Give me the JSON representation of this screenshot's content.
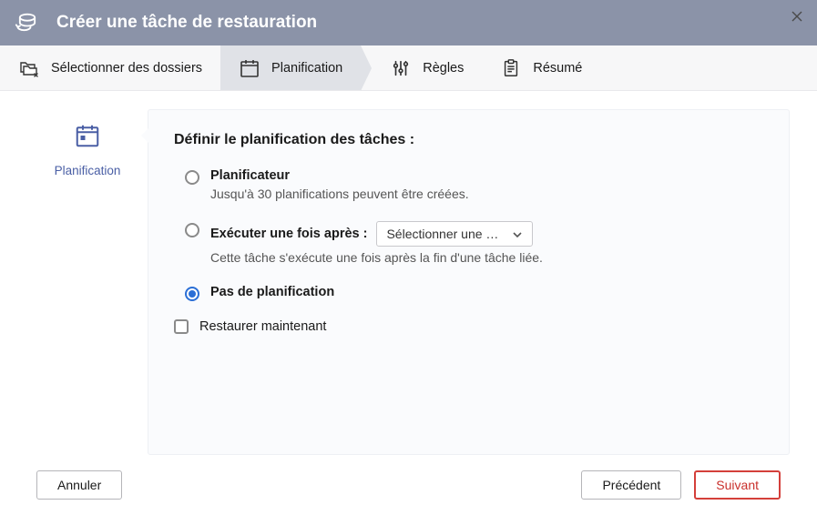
{
  "header": {
    "title": "Créer une tâche de restauration"
  },
  "steps": {
    "select_folders": "Sélectionner des dossiers",
    "scheduling": "Planification",
    "rules": "Règles",
    "summary": "Résumé"
  },
  "side": {
    "label": "Planification"
  },
  "panel": {
    "title": "Définir le planification des tâches :",
    "scheduler": {
      "label": "Planificateur",
      "desc": "Jusqu'à 30 planifications peuvent être créées."
    },
    "run_once": {
      "label": "Exécuter une fois après :",
      "select_placeholder": "Sélectionner une …",
      "desc": "Cette tâche s'exécute une fois après la fin d'une tâche liée."
    },
    "no_schedule": {
      "label": "Pas de planification"
    },
    "restore_now": {
      "label": "Restaurer maintenant"
    }
  },
  "footer": {
    "cancel": "Annuler",
    "previous": "Précédent",
    "next": "Suivant"
  }
}
